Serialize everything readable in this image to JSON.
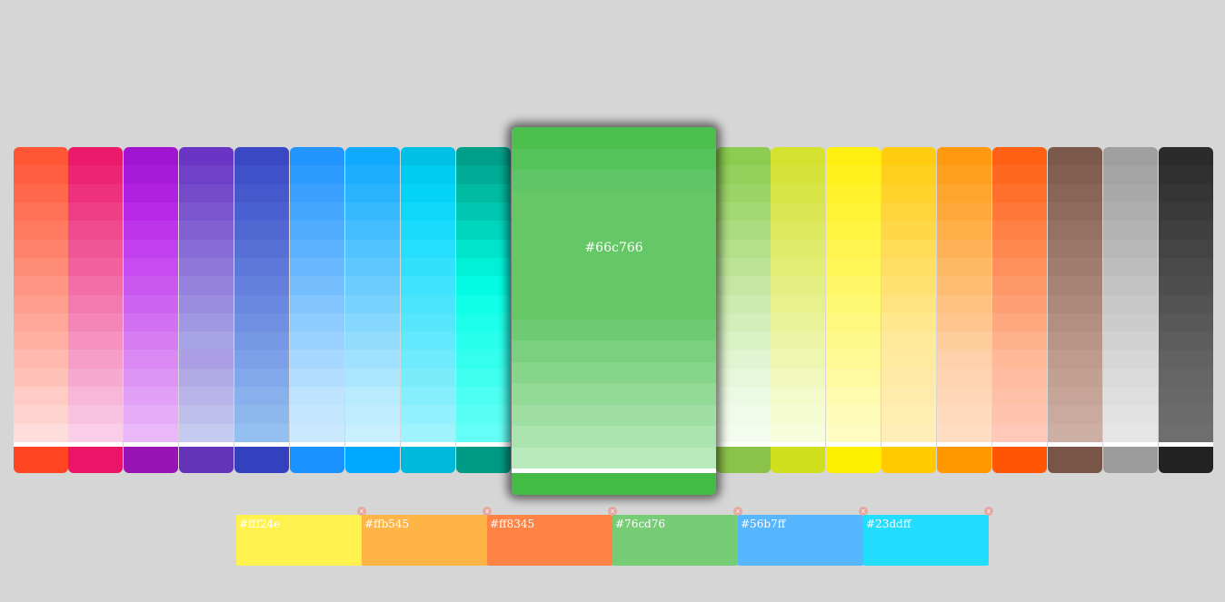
{
  "palette": [
    {
      "name": "red",
      "colors": [
        "#ff5635",
        "#ff5f40",
        "#ff684b",
        "#ff7156",
        "#ff7a61",
        "#ff836c",
        "#ff8c77",
        "#ff9582",
        "#ff9e8d",
        "#ffa798",
        "#ffb0a3",
        "#ffb9ae",
        "#ffc2b9",
        "#ffcbc4",
        "#ffd4cf",
        "#ffddda"
      ],
      "base": "#ff4521"
    },
    {
      "name": "pink",
      "colors": [
        "#ec1a6a",
        "#ec2673",
        "#ed327b",
        "#ee3e84",
        "#ef4a8c",
        "#f05695",
        "#f1629d",
        "#f26ea6",
        "#f37aae",
        "#f486b7",
        "#f592bf",
        "#f69ec8",
        "#f7aad0",
        "#f8b6d9",
        "#f9c2e1",
        "#facee9"
      ],
      "base": "#ec1466"
    },
    {
      "name": "purple",
      "colors": [
        "#a114d2",
        "#a81ad9",
        "#b020e0",
        "#b828e6",
        "#bd34ea",
        "#c140ed",
        "#c64cef",
        "#ca58f0",
        "#ce64f1",
        "#d270f2",
        "#d67cf3",
        "#da88f4",
        "#de94f5",
        "#e2a0f6",
        "#e6acf7",
        "#eab8f8"
      ],
      "base": "#9715b5"
    },
    {
      "name": "deep-purple",
      "colors": [
        "#6a35c4",
        "#7040c8",
        "#764bcb",
        "#7c56cf",
        "#8261d2",
        "#886cd6",
        "#8e77d9",
        "#9482dc",
        "#9a8ddf",
        "#a098e2",
        "#a6a3e5",
        "#ac9ee4",
        "#b2a9e7",
        "#b8b4ea",
        "#bebfed",
        "#c4caf0"
      ],
      "base": "#6433b9"
    },
    {
      "name": "indigo",
      "colors": [
        "#3a48c4",
        "#3f50c8",
        "#4558cc",
        "#4b60d0",
        "#5168d3",
        "#5770d6",
        "#5d78d9",
        "#6380dc",
        "#6988df",
        "#6f90e2",
        "#7598e5",
        "#7ba0e8",
        "#81a8ea",
        "#87b0ec",
        "#8db8ee",
        "#93c0f0"
      ],
      "base": "#3441be"
    },
    {
      "name": "blue",
      "colors": [
        "#2295ff",
        "#2e9bff",
        "#3aa1ff",
        "#46a7ff",
        "#52adff",
        "#5eb3ff",
        "#6ab9ff",
        "#76bfff",
        "#82c5ff",
        "#8ecbff",
        "#9ad1ff",
        "#a6d7ff",
        "#b2ddff",
        "#bee3ff",
        "#c4e6ff",
        "#cae9ff"
      ],
      "base": "#1a92ff"
    },
    {
      "name": "light-blue",
      "colors": [
        "#10aaff",
        "#1daffe",
        "#2ab4fe",
        "#37b9fe",
        "#44befe",
        "#51c3fe",
        "#5ec8fe",
        "#6bcdfe",
        "#78d2fe",
        "#85d7fe",
        "#92dcfe",
        "#9fe1fe",
        "#ace6fe",
        "#b9ebfe",
        "#c0edfe",
        "#c7effe"
      ],
      "base": "#00a8ff"
    },
    {
      "name": "cyan",
      "colors": [
        "#00c0e6",
        "#00cbf0",
        "#04d2f6",
        "#0ed7fa",
        "#1adbfc",
        "#26defd",
        "#32e1fd",
        "#3ee3fd",
        "#4ae5fd",
        "#56e7fd",
        "#62e9fd",
        "#6eebfd",
        "#7aedfd",
        "#86effd",
        "#92f1fd",
        "#9ef3fd"
      ],
      "base": "#00b8d9"
    },
    {
      "name": "teal",
      "colors": [
        "#009f8a",
        "#00ac95",
        "#00baa2",
        "#00c8b0",
        "#00d6be",
        "#00e4cc",
        "#00f0d8",
        "#04fae2",
        "#10ffe8",
        "#1cffea",
        "#28ffec",
        "#34ffee",
        "#40fff0",
        "#4cfff2",
        "#58fff4",
        "#64fff6"
      ],
      "base": "#009b85"
    },
    {
      "name": "green",
      "colors": [
        "#4dbf4d",
        "#56c25a",
        "#5fc566",
        "#66c766",
        "#66c766",
        "#66c766",
        "#66c766",
        "#66c766",
        "#66c766",
        "#6fcb73",
        "#7bd07f",
        "#87d58b",
        "#93da97",
        "#9fdfa3",
        "#abe4af",
        "#b7e9bb"
      ],
      "base": "#44bb44",
      "label": "#66c766"
    },
    {
      "name": "light-green",
      "colors": [
        "#8ccc50",
        "#94d05c",
        "#9cd468",
        "#a4d874",
        "#acdc80",
        "#b4e08c",
        "#bce498",
        "#c4e8a4",
        "#cbecb0",
        "#d2efbb",
        "#d9f2c6",
        "#e0f5d1",
        "#e6f7da",
        "#ecf9e3",
        "#f0fbe9",
        "#f4fcef"
      ],
      "base": "#8bc34a"
    },
    {
      "name": "lime",
      "colors": [
        "#d3e22e",
        "#d5e33a",
        "#d8e546",
        "#dae752",
        "#dde95e",
        "#dfeb6a",
        "#e2ed76",
        "#e4ef82",
        "#e7f18e",
        "#e9f39a",
        "#ecf5a6",
        "#eef7b2",
        "#f1f9be",
        "#f3fbca",
        "#f5fcd2",
        "#f7fdda"
      ],
      "base": "#d1e01e"
    },
    {
      "name": "yellow",
      "colors": [
        "#fff012",
        "#fff11e",
        "#fff22a",
        "#fff336",
        "#fff442",
        "#fff54e",
        "#fff65a",
        "#fff766",
        "#fff872",
        "#fff87e",
        "#fff88a",
        "#fff996",
        "#fffaa2",
        "#fffbae",
        "#fffbb8",
        "#fffcc2"
      ],
      "base": "#ffef00"
    },
    {
      "name": "amber",
      "colors": [
        "#ffcc10",
        "#ffcf1e",
        "#ffd22c",
        "#ffd53a",
        "#ffd848",
        "#ffdb56",
        "#ffde64",
        "#ffe172",
        "#ffe480",
        "#ffe78e",
        "#ffea9c",
        "#ffeaa0",
        "#ffeba6",
        "#ffecac",
        "#ffedb2",
        "#ffeeb8"
      ],
      "base": "#ffcb00"
    },
    {
      "name": "orange",
      "colors": [
        "#ff9a10",
        "#ff9f1e",
        "#ffa42c",
        "#ffa93a",
        "#ffae48",
        "#ffb356",
        "#ffb864",
        "#ffbd72",
        "#ffc280",
        "#ffc78e",
        "#ffcc9c",
        "#ffd1aa",
        "#ffd4b0",
        "#ffd7b6",
        "#ffdabc",
        "#ffddc2"
      ],
      "base": "#ff9800"
    },
    {
      "name": "deep-orange",
      "colors": [
        "#ff6014",
        "#ff6820",
        "#ff702c",
        "#ff7838",
        "#ff8044",
        "#ff8850",
        "#ff905c",
        "#ff9868",
        "#ffa074",
        "#ffa880",
        "#ffb08c",
        "#ffb898",
        "#ffbca0",
        "#ffc0a8",
        "#ffc4b0",
        "#ffc8b8"
      ],
      "base": "#ff5505"
    },
    {
      "name": "brown",
      "colors": [
        "#7c5a4b",
        "#825f50",
        "#886556",
        "#8e6b5c",
        "#947162",
        "#9a7768",
        "#a07d6e",
        "#a68374",
        "#ac897a",
        "#b28f80",
        "#b89586",
        "#be9b8c",
        "#c2a092",
        "#c6a598",
        "#caaa9e",
        "#ceafa4"
      ],
      "base": "#795548"
    },
    {
      "name": "grey",
      "colors": [
        "#9f9f9f",
        "#a4a4a4",
        "#a9a9a9",
        "#aeaeae",
        "#b3b3b3",
        "#b8b8b8",
        "#bdbdbd",
        "#c2c2c2",
        "#c7c7c7",
        "#cccccc",
        "#d1d1d1",
        "#d6d6d6",
        "#dadada",
        "#dedede",
        "#e2e2e2",
        "#e6e6e6"
      ],
      "base": "#9c9c9c"
    },
    {
      "name": "black",
      "colors": [
        "#2b2b2b",
        "#303030",
        "#353535",
        "#3a3a3a",
        "#3f3f3f",
        "#444444",
        "#494949",
        "#4e4e4e",
        "#535353",
        "#585858",
        "#5d5d5d",
        "#626262",
        "#656565",
        "#686868",
        "#6b6b6b",
        "#6e6e6e"
      ],
      "base": "#222222"
    }
  ],
  "active_index": 9,
  "saved_colors": [
    {
      "hex": "#fff24e"
    },
    {
      "hex": "#ffb545"
    },
    {
      "hex": "#ff8345"
    },
    {
      "hex": "#76cd76"
    },
    {
      "hex": "#56b7ff"
    },
    {
      "hex": "#23ddff"
    }
  ],
  "remove_glyph": "x"
}
